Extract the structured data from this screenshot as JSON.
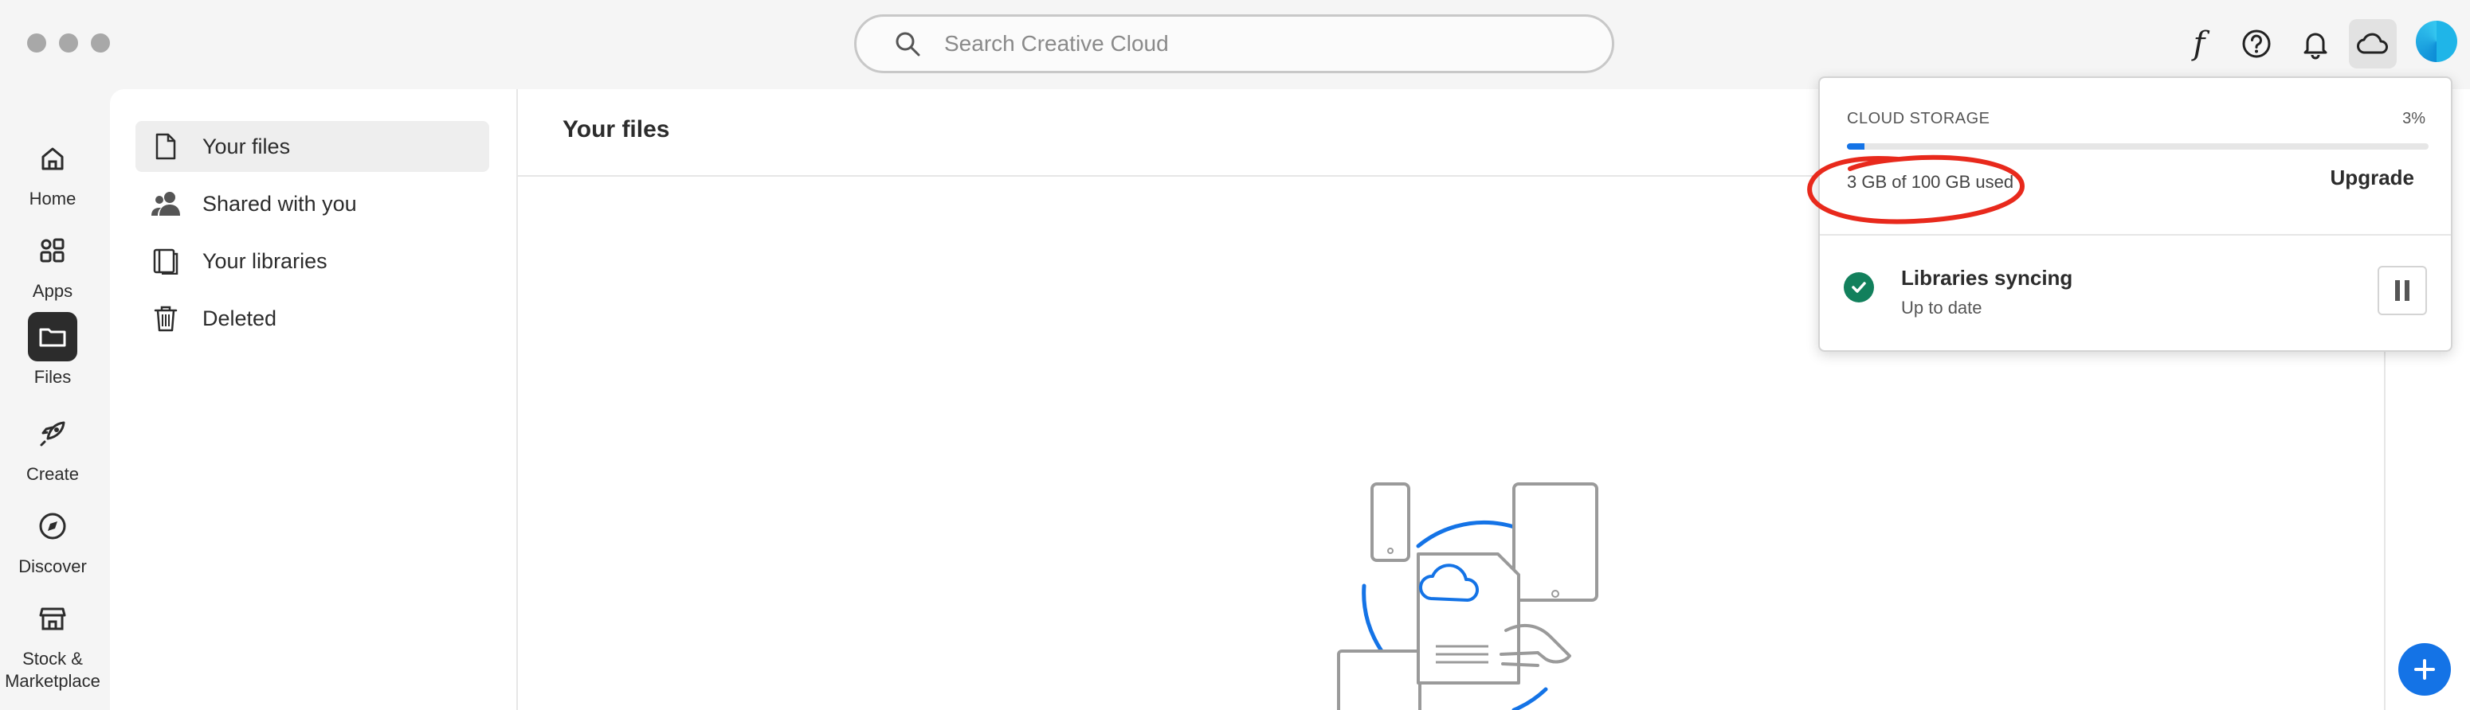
{
  "search": {
    "placeholder": "Search Creative Cloud"
  },
  "topbar": {
    "font_glyph": "f"
  },
  "nav": {
    "items": [
      {
        "label": "Home"
      },
      {
        "label": "Apps"
      },
      {
        "label": "Files"
      },
      {
        "label": "Create"
      },
      {
        "label": "Discover"
      },
      {
        "label": "Stock &",
        "label2": "Marketplace"
      }
    ],
    "active": "Files"
  },
  "subnav": {
    "items": [
      {
        "label": "Your files",
        "icon": "file-icon"
      },
      {
        "label": "Shared with you",
        "icon": "people-icon"
      },
      {
        "label": "Your libraries",
        "icon": "libraries-icon"
      },
      {
        "label": "Deleted",
        "icon": "trash-icon"
      }
    ]
  },
  "content": {
    "title": "Your files"
  },
  "storage": {
    "heading": "CLOUD STORAGE",
    "percent": "3%",
    "used_fraction": 0.03,
    "used_text": "3 GB of 100 GB used",
    "upgrade": "Upgrade"
  },
  "sync": {
    "title": "Libraries syncing",
    "status": "Up to date"
  },
  "colors": {
    "accent": "#1473e6",
    "success": "#12805c",
    "annotation": "#e8291c"
  }
}
